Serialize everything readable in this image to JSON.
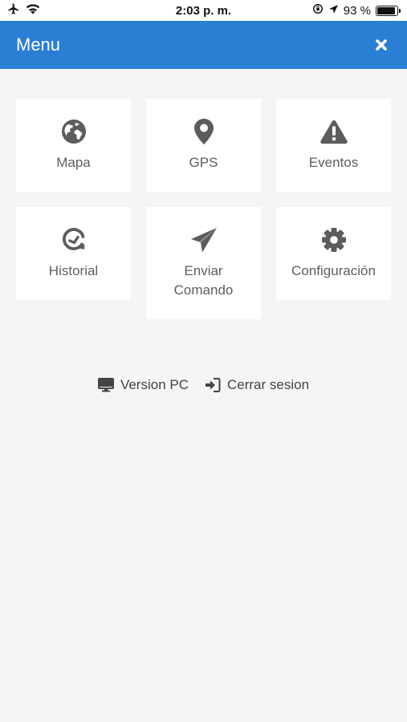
{
  "status_bar": {
    "time": "2:03 p. m.",
    "battery_percent": "93 %",
    "battery_level": 0.93
  },
  "header": {
    "title": "Menu"
  },
  "menu_items": [
    {
      "label": "Mapa",
      "icon": "globe-icon"
    },
    {
      "label": "GPS",
      "icon": "map-marker-icon"
    },
    {
      "label": "Eventos",
      "icon": "warning-icon"
    },
    {
      "label": "Historial",
      "icon": "history-icon"
    },
    {
      "label_line1": "Enviar",
      "label_line2": "Comando",
      "icon": "paper-plane-icon"
    },
    {
      "label": "Configuración",
      "icon": "gear-icon"
    }
  ],
  "footer": {
    "pc_version": "Version PC",
    "logout": "Cerrar sesion"
  },
  "colors": {
    "accent": "#2a7fd4",
    "icon": "#5c5c5c",
    "background": "#f5f5f5",
    "tile": "#ffffff"
  }
}
